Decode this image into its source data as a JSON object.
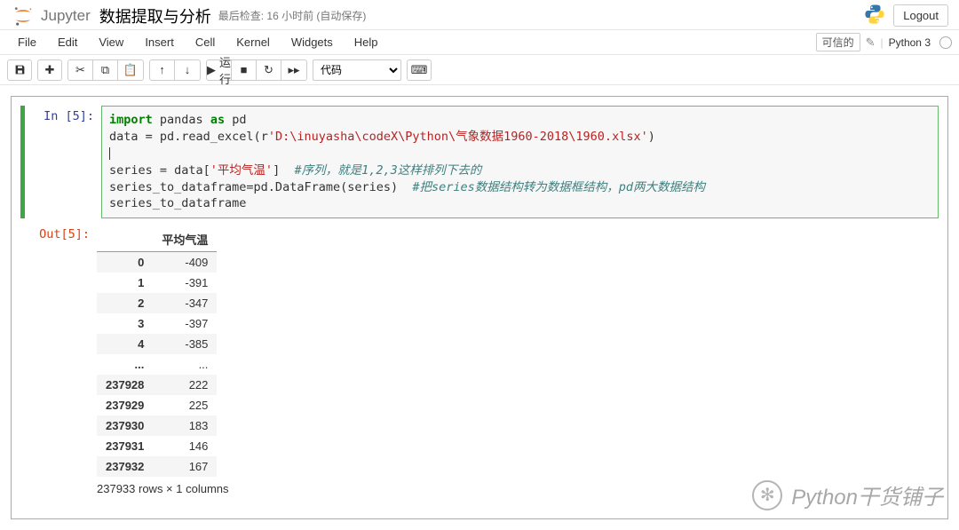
{
  "header": {
    "logo_text": "Jupyter",
    "notebook_name": "数据提取与分析",
    "save_status": "最后检查: 16 小时前 (自动保存)",
    "logout": "Logout"
  },
  "menubar": {
    "items": [
      "File",
      "Edit",
      "View",
      "Insert",
      "Cell",
      "Kernel",
      "Widgets",
      "Help"
    ],
    "trusted": "可信的",
    "kernel": "Python 3"
  },
  "toolbar": {
    "run_label": "运行",
    "celltype": "代码"
  },
  "cell": {
    "in_prompt": "In [5]:",
    "out_prompt": "Out[5]:",
    "code": {
      "kw_import": "import",
      "pandas": " pandas ",
      "kw_as": "as",
      "pd": " pd",
      "line2a": "data = pd.read_excel(",
      "rprefix": "r",
      "path": "'D:\\inuyasha\\codeX\\Python\\气象数据1960-2018\\1960.xlsx'",
      "line2b": ")",
      "line4a": "series = data[",
      "col": "'平均气温'",
      "line4b": "]  ",
      "comment1": "#序列，就是1,2,3这样排列下去的",
      "line5a": "series_to_dataframe=pd.DataFrame(series)  ",
      "comment2": "#把series数据结构转为数据框结构，pd两大数据结构",
      "line6": "series_to_dataframe"
    }
  },
  "dataframe": {
    "column": "平均气温",
    "rows": [
      {
        "idx": "0",
        "val": "-409"
      },
      {
        "idx": "1",
        "val": "-391"
      },
      {
        "idx": "2",
        "val": "-347"
      },
      {
        "idx": "3",
        "val": "-397"
      },
      {
        "idx": "4",
        "val": "-385"
      },
      {
        "idx": "...",
        "val": "..."
      },
      {
        "idx": "237928",
        "val": "222"
      },
      {
        "idx": "237929",
        "val": "225"
      },
      {
        "idx": "237930",
        "val": "183"
      },
      {
        "idx": "237931",
        "val": "146"
      },
      {
        "idx": "237932",
        "val": "167"
      }
    ],
    "info": "237933 rows × 1 columns"
  },
  "watermark": "Python干货铺子"
}
